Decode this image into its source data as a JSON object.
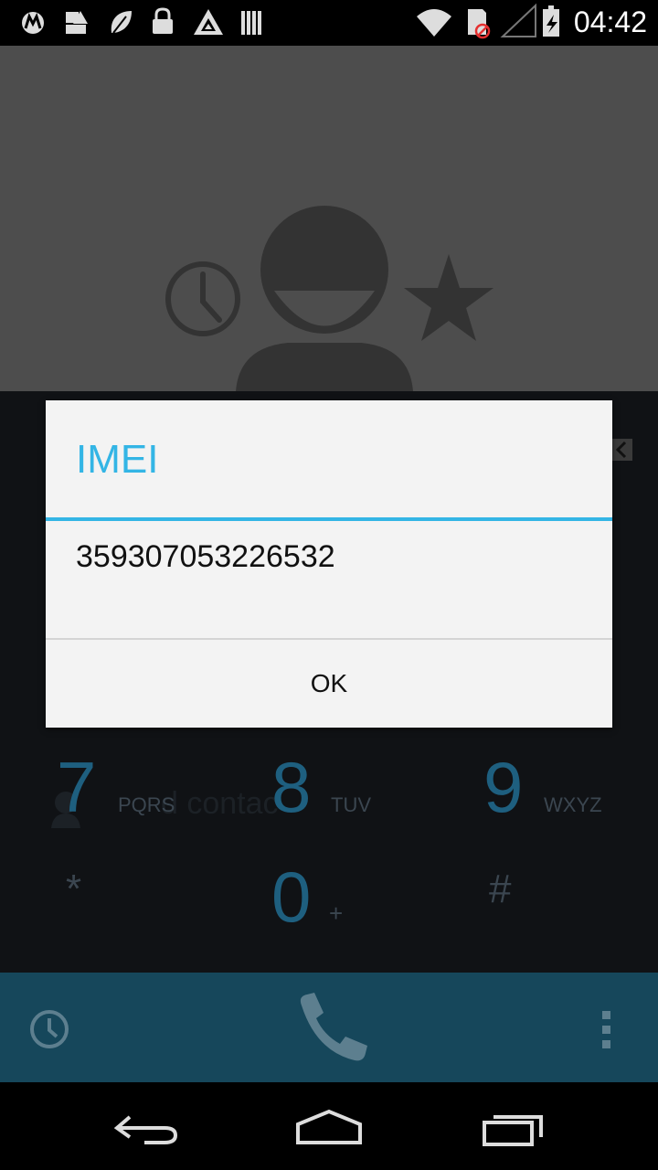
{
  "status_bar": {
    "time": "04:42",
    "icons": [
      "motorola-icon",
      "notification-icon",
      "leaf-icon",
      "lock-icon",
      "triangle-logo-icon",
      "bars-icon",
      "wifi-icon",
      "sim-blocked-icon",
      "signal-icon",
      "battery-charging-icon"
    ]
  },
  "dialer": {
    "keys": [
      {
        "digit": "7",
        "letters": "PQRS"
      },
      {
        "digit": "8",
        "letters": "TUV"
      },
      {
        "digit": "9",
        "letters": "WXYZ"
      },
      {
        "digit": "*",
        "letters": ""
      },
      {
        "digit": "0",
        "letters": "+"
      },
      {
        "digit": "#",
        "letters": ""
      }
    ],
    "background_text": "d contac"
  },
  "dialog": {
    "title": "IMEI",
    "message": "359307053226532",
    "ok_label": "OK"
  },
  "colors": {
    "accent": "#33b5e5",
    "action_bar": "#16475b",
    "header_bg": "#4d4d4d"
  }
}
